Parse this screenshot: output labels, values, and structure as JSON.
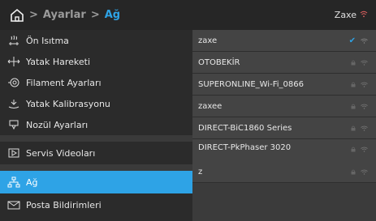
{
  "header": {
    "breadcrumb": [
      "Ayarlar",
      "Ağ"
    ],
    "separator": ">",
    "user": "Zaxe"
  },
  "sidebar": {
    "items": [
      {
        "label": "Ön Isıtma",
        "icon": "heat-icon"
      },
      {
        "label": "Yatak Hareketi",
        "icon": "move-icon"
      },
      {
        "label": "Filament Ayarları",
        "icon": "filament-icon"
      },
      {
        "label": "Yatak Kalibrasyonu",
        "icon": "calibration-icon"
      },
      {
        "label": "Nozül Ayarları",
        "icon": "nozzle-icon"
      },
      {
        "label": "Servis Videoları",
        "icon": "video-icon"
      },
      {
        "label": "Ağ",
        "icon": "network-icon"
      },
      {
        "label": "Posta Bildirimleri",
        "icon": "mail-icon"
      }
    ],
    "active_index": 6
  },
  "networks": [
    {
      "ssid": "zaxe",
      "connected": true,
      "locked": false
    },
    {
      "ssid": "OTOBEKİR",
      "connected": false,
      "locked": true
    },
    {
      "ssid": "SUPERONLINE_Wi-Fi_0866",
      "connected": false,
      "locked": true
    },
    {
      "ssid": "zaxee",
      "connected": false,
      "locked": true
    },
    {
      "ssid": "DIRECT-BiC1860 Series",
      "connected": false,
      "locked": true
    },
    {
      "ssid": "DIRECT-PkPhaser 3020",
      "connected": false,
      "locked": true
    },
    {
      "ssid": "z",
      "connected": false,
      "locked": true
    }
  ],
  "colors": {
    "accent": "#2ea3e6",
    "header_bg": "#262626",
    "sidebar_bg": "#2b2b2b",
    "row_bg": "#444444"
  }
}
